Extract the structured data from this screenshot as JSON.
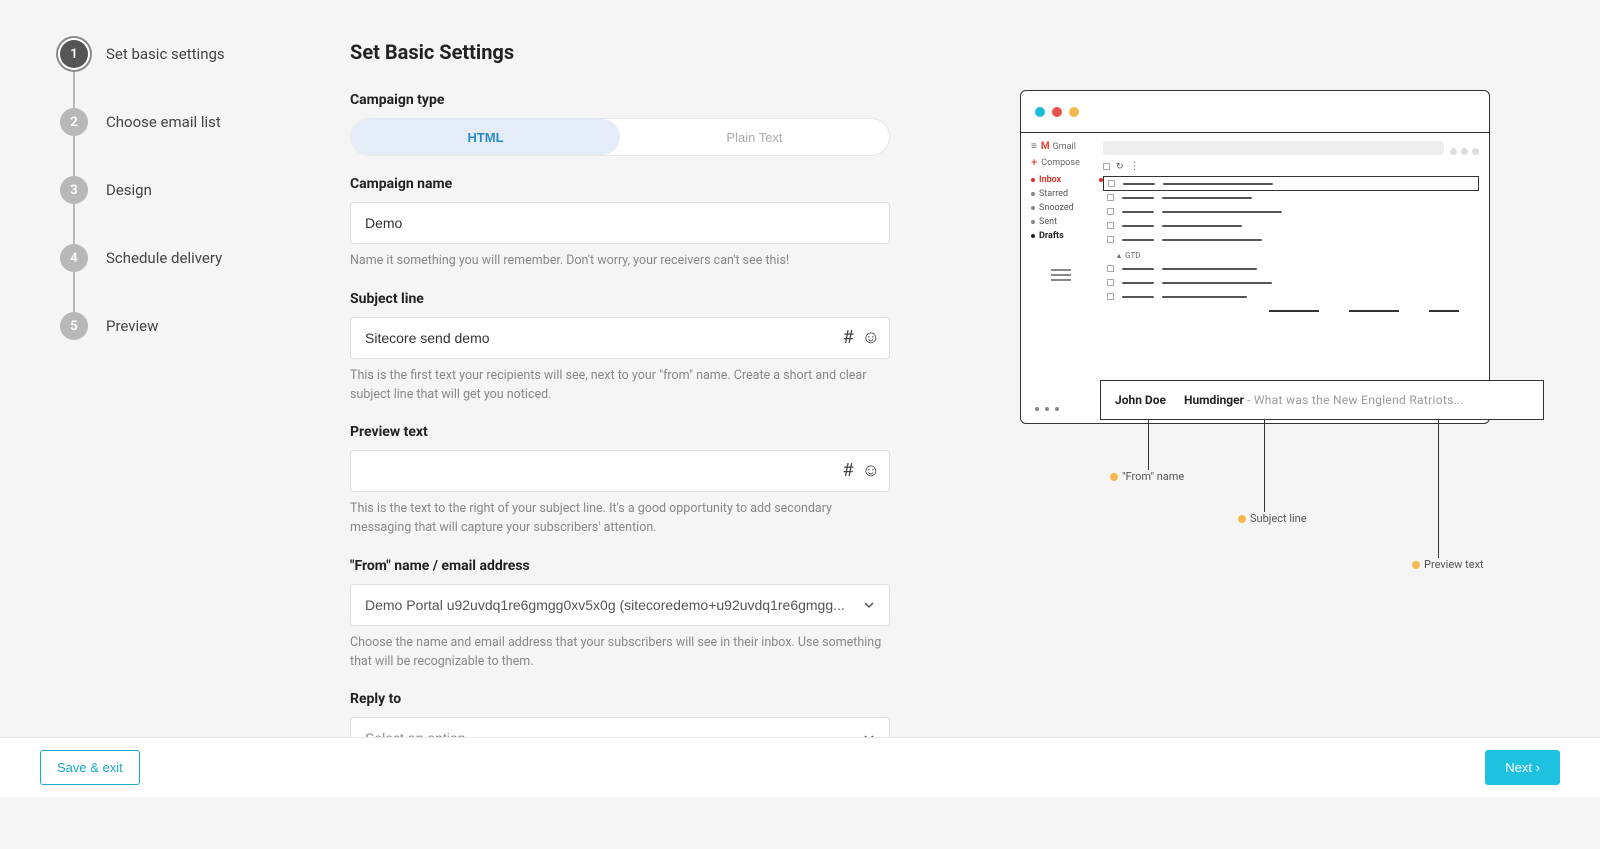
{
  "page_title": "Set Basic Settings",
  "steps": [
    {
      "num": "1",
      "label": "Set basic settings",
      "active": true
    },
    {
      "num": "2",
      "label": "Choose email list",
      "active": false
    },
    {
      "num": "3",
      "label": "Design",
      "active": false
    },
    {
      "num": "4",
      "label": "Schedule delivery",
      "active": false
    },
    {
      "num": "5",
      "label": "Preview",
      "active": false
    }
  ],
  "fields": {
    "campaign_type": {
      "label": "Campaign type",
      "options": {
        "html": "HTML",
        "plain": "Plain Text"
      }
    },
    "campaign_name": {
      "label": "Campaign name",
      "value": "Demo",
      "helper": "Name it something you will remember. Don't worry, your receivers can't see this!"
    },
    "subject_line": {
      "label": "Subject line",
      "value": "Sitecore send demo",
      "helper": "This is the first text your recipients will see, next to your \"from\" name. Create a short and clear subject line that will get you noticed."
    },
    "preview_text": {
      "label": "Preview text",
      "value": "",
      "helper": "This is the text to the right of your subject line. It's a good opportunity to add secondary messaging that will capture your subscribers' attention."
    },
    "from": {
      "label": "\"From\" name / email address",
      "value": "Demo Portal u92uvdq1re6gmgg0xv5x0g (sitecoredemo+u92uvdq1re6gmgg...",
      "helper": "Choose the name and email address that your subscribers will see in their inbox. Use something that will be recognizable to them."
    },
    "reply_to": {
      "label": "Reply to",
      "placeholder": "Select an option"
    }
  },
  "mock": {
    "gmail_label": "Gmail",
    "compose": "Compose",
    "folders": {
      "inbox": "Inbox",
      "starred": "Starred",
      "snoozed": "Snoozed",
      "sent": "Sent",
      "drafts": "Drafts"
    },
    "gtd": "GTD",
    "callout": {
      "from": "John Doe",
      "subject": "Humdinger",
      "preview": "- What was the New Englend Ratriots..."
    },
    "annotations": {
      "from": "\"From\" name",
      "subject": "Subject line",
      "preview": "Preview text"
    }
  },
  "footer": {
    "save_exit": "Save & exit",
    "next": "Next"
  }
}
